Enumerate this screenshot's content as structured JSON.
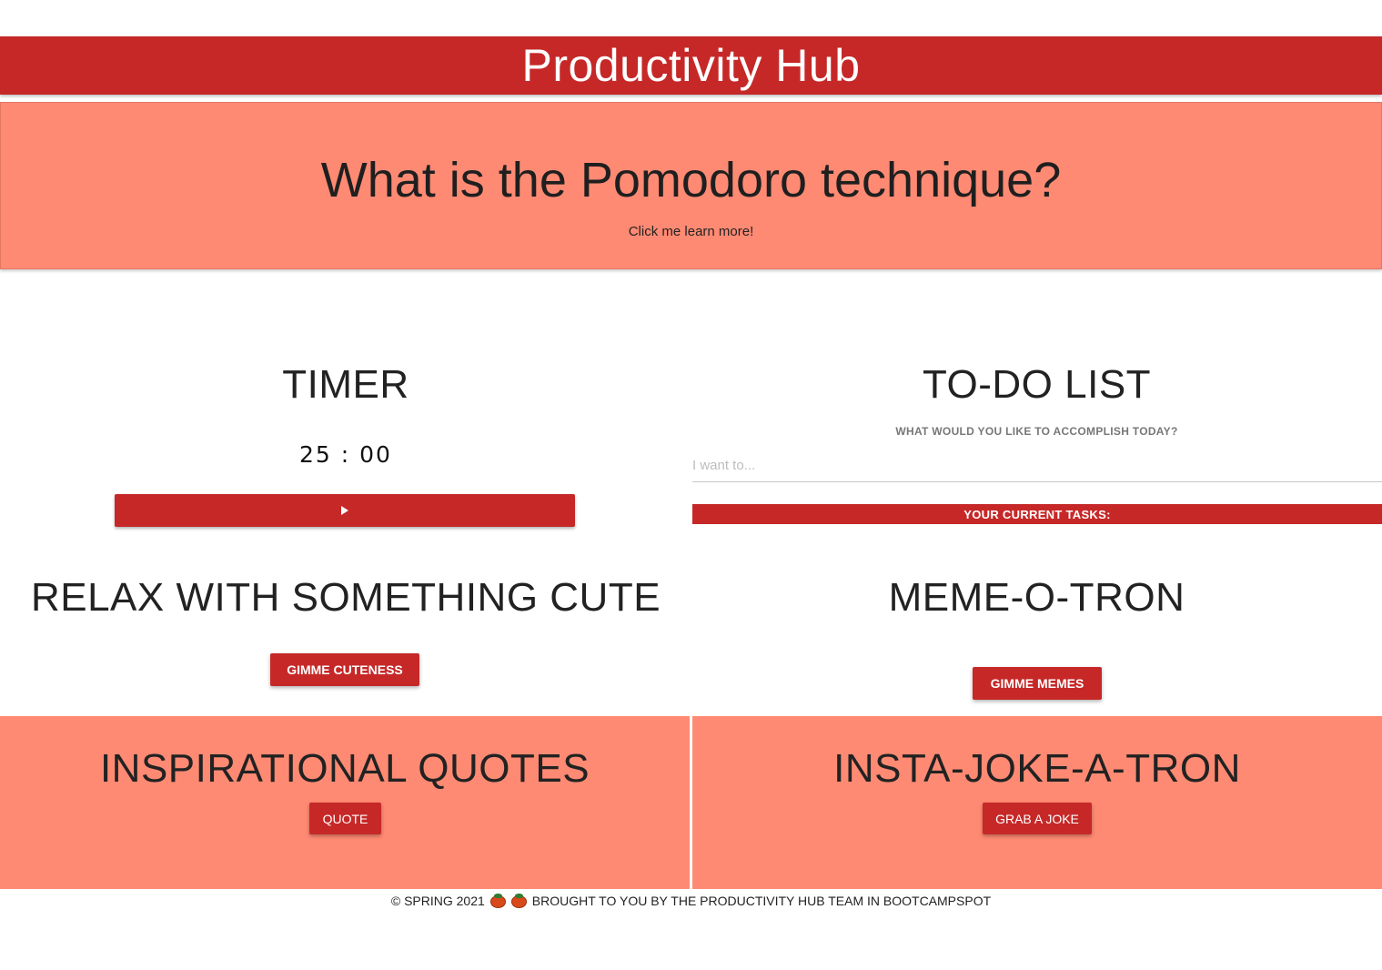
{
  "navbar": {
    "brand": "Productivity Hub"
  },
  "hero": {
    "title": "What is the Pomodoro technique?",
    "link": "Click me learn more!"
  },
  "timer": {
    "title": "TIMER",
    "display": "25 : 00",
    "start_icon": "play-icon"
  },
  "todo": {
    "title": "TO-DO LIST",
    "prompt": "WHAT WOULD YOU LIKE TO ACCOMPLISH TODAY?",
    "input_placeholder": "I want to...",
    "input_value": "",
    "tasks_header": "YOUR CURRENT TASKS:"
  },
  "cute": {
    "title": "RELAX WITH SOMETHING CUTE",
    "button": "GIMME CUTENESS"
  },
  "meme": {
    "title": "MEME-O-TRON",
    "button": "GIMME MEMES"
  },
  "quotes": {
    "title": "INSPIRATIONAL QUOTES",
    "button": "QUOTE"
  },
  "joke": {
    "title": "INSTA-JOKE-A-TRON",
    "button": "GRAB A JOKE"
  },
  "footer": {
    "left": "© SPRING 2021",
    "right": "BROUGHT TO YOU BY THE PRODUCTIVITY HUB TEAM IN BOOTCAMPSPOT",
    "icons": [
      "tomato-icon",
      "tomato-icon"
    ]
  },
  "colors": {
    "primary_red": "#c62828",
    "salmon": "#ff8a73",
    "text_dark": "#222222"
  }
}
